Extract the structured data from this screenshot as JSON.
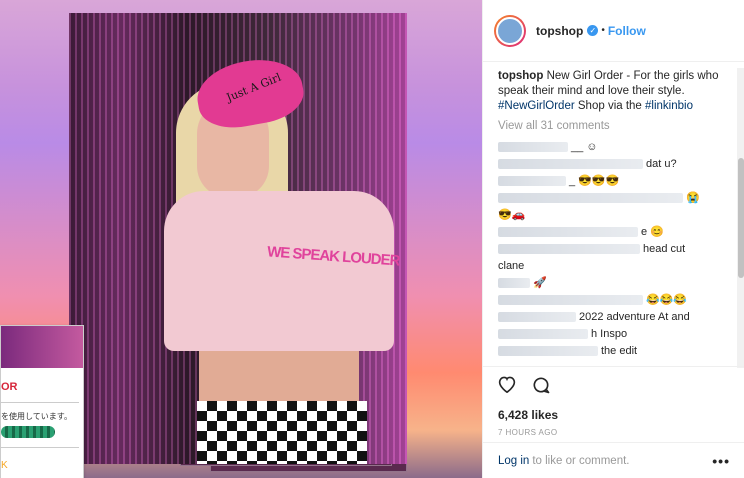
{
  "post_image": {
    "hat_text": "Just A Girl",
    "shirt_text": "WE SPEAK LOUDER"
  },
  "background_popup": {
    "title": "OR",
    "line": "を使用しています。",
    "link": "K"
  },
  "header": {
    "username": "topshop",
    "verified_icon": "check-icon",
    "separator": "•",
    "follow_label": "Follow"
  },
  "caption": {
    "username": "topshop",
    "text": "New Girl Order - For the girls who speak their mind and love their style.",
    "hashtag": "#NewGirlOrder",
    "text2": "Shop via the",
    "link_tag": "#linkinbio"
  },
  "view_all_comments": "View all 31 comments",
  "comments": [
    {
      "text": "__ ☺"
    },
    {
      "text": "dat u?"
    },
    {
      "text": "_ 😎😎😎"
    },
    {
      "text": "😭"
    },
    {
      "text": "😎🚗"
    },
    {
      "text": "e 😊"
    },
    {
      "text": "head cut"
    },
    {
      "text": "clane"
    },
    {
      "text": "🚀"
    },
    {
      "text": "😂😂😂"
    },
    {
      "text": "2022 adventure At and"
    },
    {
      "text": "h Inspo"
    },
    {
      "text": "the edit"
    }
  ],
  "actions": {
    "like_icon": "heart-icon",
    "comment_icon": "comment-icon",
    "likes_count": "6,428 likes",
    "timestamp": "7 HOURS AGO"
  },
  "footer": {
    "login_label": "Log in",
    "login_suffix": "to like or comment.",
    "more_label": "•••"
  },
  "colors": {
    "link_blue": "#3897f0",
    "hashtag_blue": "#003569"
  }
}
